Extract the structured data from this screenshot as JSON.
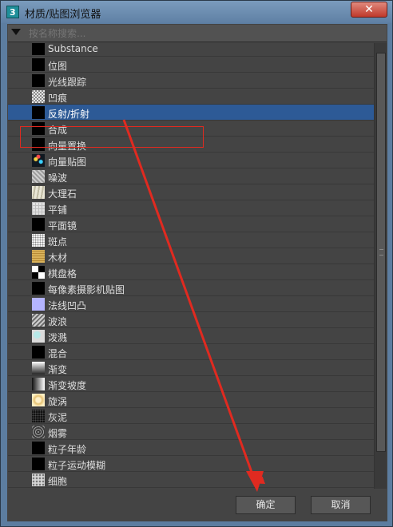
{
  "window": {
    "title": "材质/贴图浏览器",
    "app_icon": "3ds-max-icon",
    "close_label": "✕"
  },
  "search": {
    "placeholder": "按名称搜索...",
    "toggle_icon": "triangle-down-icon"
  },
  "items": [
    {
      "label": "Substance",
      "thumb": "black"
    },
    {
      "label": "位图",
      "thumb": "black"
    },
    {
      "label": "光线跟踪",
      "thumb": "black"
    },
    {
      "label": "凹痕",
      "thumb": "dent-pattern"
    },
    {
      "label": "反射/折射",
      "thumb": "black",
      "selected": true
    },
    {
      "label": "合成",
      "thumb": "black"
    },
    {
      "label": "向量置换",
      "thumb": "black"
    },
    {
      "label": "向量贴图",
      "thumb": "vector-pattern"
    },
    {
      "label": "噪波",
      "thumb": "noise-pattern"
    },
    {
      "label": "大理石",
      "thumb": "marble-pattern"
    },
    {
      "label": "平铺",
      "thumb": "tiles-pattern"
    },
    {
      "label": "平面镜",
      "thumb": "black"
    },
    {
      "label": "斑点",
      "thumb": "speckle-pattern"
    },
    {
      "label": "木材",
      "thumb": "wood-pattern"
    },
    {
      "label": "棋盘格",
      "thumb": "checker-pattern"
    },
    {
      "label": "每像素摄影机贴图",
      "thumb": "black"
    },
    {
      "label": "法线凹凸",
      "thumb": "normal-pattern"
    },
    {
      "label": "波浪",
      "thumb": "waves-pattern"
    },
    {
      "label": "泼溅",
      "thumb": "splat-pattern"
    },
    {
      "label": "混合",
      "thumb": "black"
    },
    {
      "label": "渐变",
      "thumb": "gradient-pattern"
    },
    {
      "label": "渐变坡度",
      "thumb": "gradient-ramp-pattern"
    },
    {
      "label": "旋涡",
      "thumb": "swirl-pattern"
    },
    {
      "label": "灰泥",
      "thumb": "stucco-pattern"
    },
    {
      "label": "烟雾",
      "thumb": "smoke-pattern"
    },
    {
      "label": "粒子年龄",
      "thumb": "black"
    },
    {
      "label": "粒子运动模糊",
      "thumb": "black"
    },
    {
      "label": "细胞",
      "thumb": "cellular-pattern"
    }
  ],
  "buttons": {
    "ok": "确定",
    "cancel": "取消"
  },
  "colors": {
    "selection": "#2d5a96",
    "annotation": "#e02a20",
    "background": "#444444"
  }
}
